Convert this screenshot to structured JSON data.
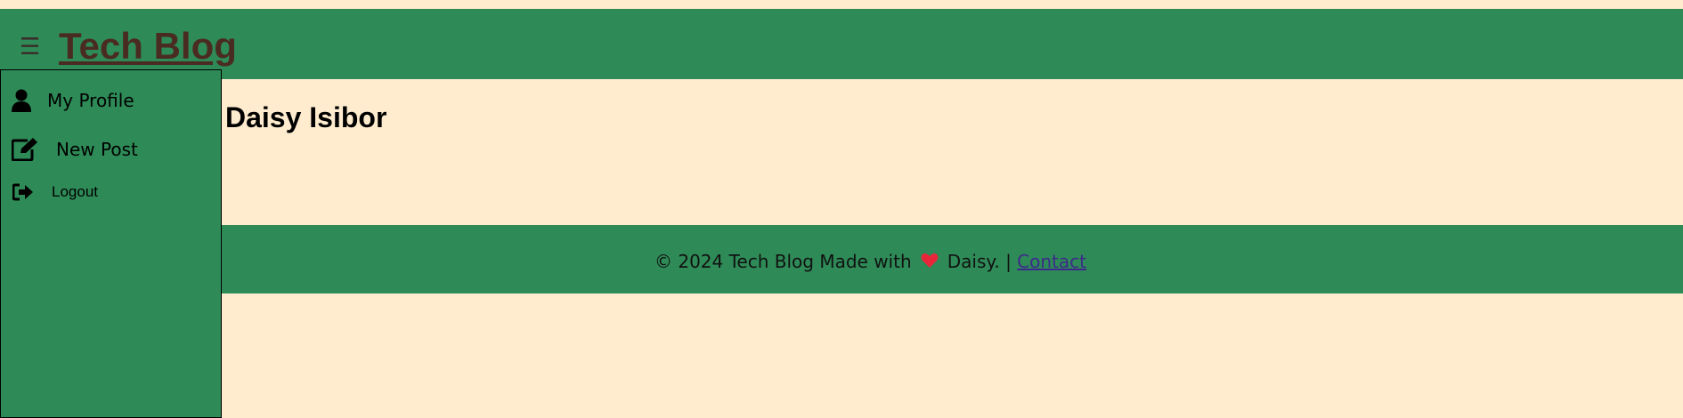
{
  "header": {
    "menu_icon": "hamburger-icon",
    "title": "Tech Blog",
    "background": "#2e8b57",
    "title_color": "#4a2b22"
  },
  "sidebar": {
    "items": [
      {
        "icon": "user-icon",
        "label": "My Profile"
      },
      {
        "icon": "edit-icon",
        "label": "New Post"
      },
      {
        "icon": "logout-icon",
        "label": "Logout"
      }
    ]
  },
  "main": {
    "heading": "Daisy Isibor",
    "background": "#ffecce"
  },
  "footer": {
    "prefix": "© 2024 Tech Blog Made with",
    "heart_icon": "heart-icon",
    "suffix": "Daisy. |",
    "contact_label": "Contact"
  }
}
